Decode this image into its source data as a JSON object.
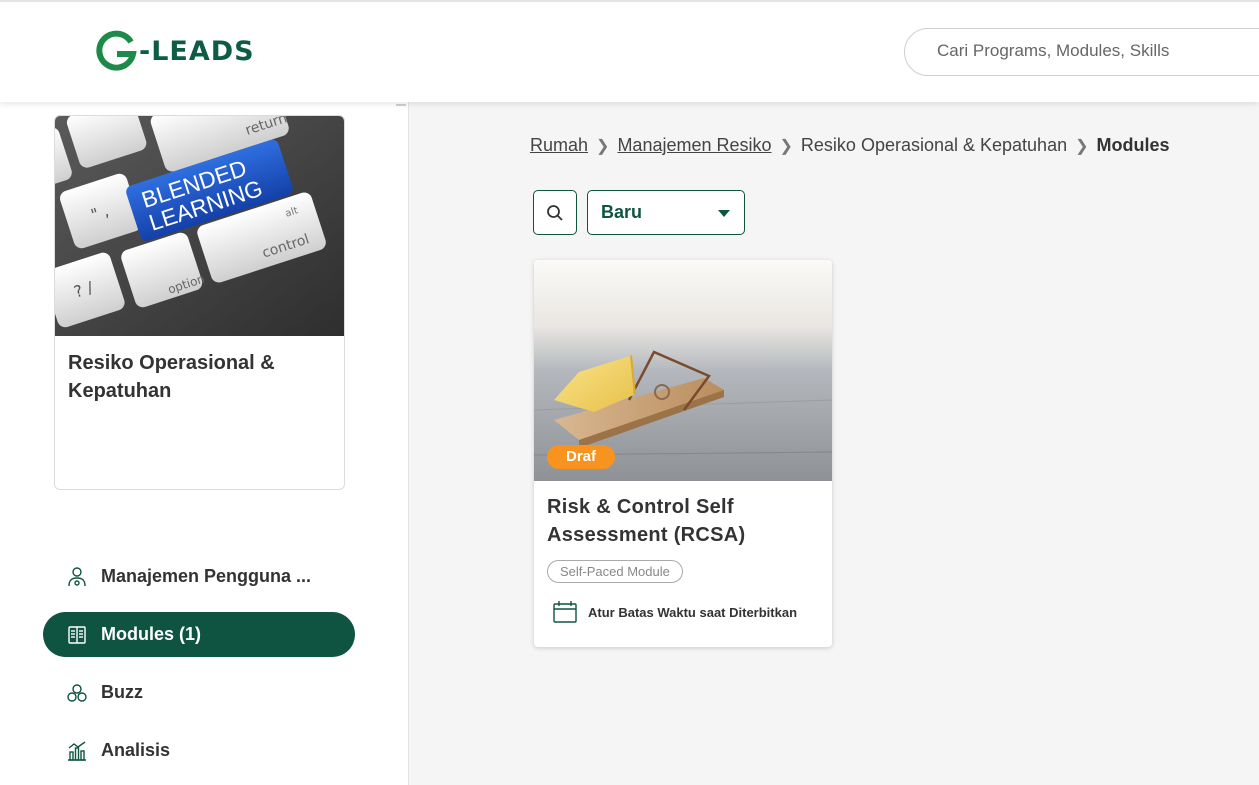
{
  "header": {
    "logo_text": "-LEADS",
    "logo_letter": "G",
    "search_placeholder": "Cari Programs, Modules, Skills"
  },
  "sidebar": {
    "program": {
      "image_text": [
        "BLENDED",
        "LEARNING"
      ],
      "title": "Resiko Operasional & Kepatuhan"
    },
    "items": [
      {
        "label": "Manajemen Pengguna ...",
        "icon": "users-gear-icon",
        "active": false
      },
      {
        "label": "Modules (1)",
        "icon": "book-icon",
        "active": true
      },
      {
        "label": "Buzz",
        "icon": "buzz-icon",
        "active": false
      },
      {
        "label": "Analisis",
        "icon": "chart-icon",
        "active": false
      }
    ]
  },
  "breadcrumb": {
    "items": [
      "Rumah",
      "Manajemen Resiko",
      "Resiko Operasional & Kepatuhan"
    ],
    "current": "Modules"
  },
  "toolbar": {
    "sort_value": "Baru"
  },
  "modules": [
    {
      "title": "Risk & Control Self Assessment (RCSA)",
      "status": "Draf",
      "type": "Self-Paced Module",
      "deadline": "Atur Batas Waktu saat Diterbitkan"
    }
  ],
  "colors": {
    "brand_green": "#0e5441",
    "logo_green": "#1e8a4a",
    "draft_orange": "#f7931e"
  }
}
